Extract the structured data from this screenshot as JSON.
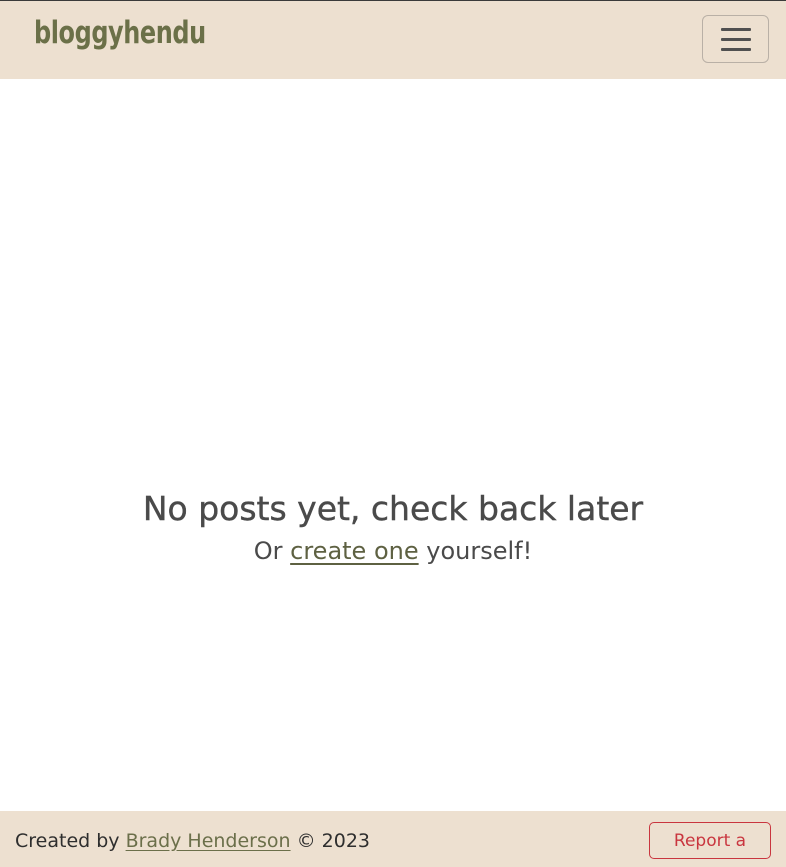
{
  "navbar": {
    "brand": "bloggyhendu",
    "toggler_icon": "hamburger-menu-icon"
  },
  "main": {
    "title": "No posts yet, check back later",
    "sub_prefix": "Or ",
    "sub_link": "create one",
    "sub_suffix": " yourself!"
  },
  "footer": {
    "created_by": "Created by ",
    "author": "Brady Henderson",
    "copyright": " © 2023",
    "report_bug": "Report a Bug"
  },
  "colors": {
    "navbar_bg": "#ede0d0",
    "brand": "#6b7048",
    "link": "#5e6142",
    "danger": "#c9363f"
  }
}
